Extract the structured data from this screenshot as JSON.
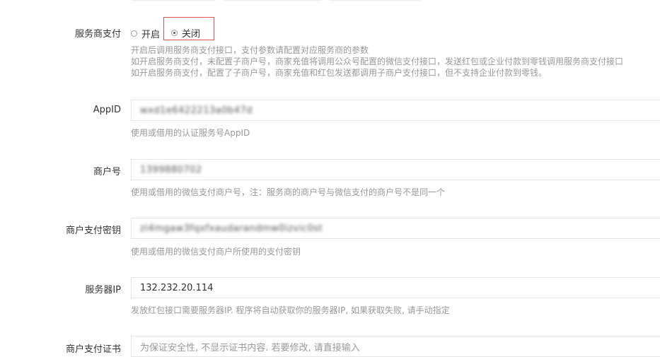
{
  "fields": {
    "sub_merchant_pay": {
      "label": "服务商支付",
      "option_on": "开启",
      "option_off": "关闭",
      "selected": "关闭",
      "help": [
        "开启后调用服务商支付接口，支付参数请配置对应服务商的参数",
        "如开启服务商支付，未配置子商户号，商家充值将调用公众号配置的微信支付接口，发送红包或企业付款到零钱调用服务商支付接口",
        "如开启服务商支付，配置了子商户号，商家充值和红包发送都调用子商户支付接口，但不支持企业付款到零钱。"
      ]
    },
    "appid": {
      "label": "AppID",
      "value": "wxd1e6422213a0b47d",
      "help": "使用或借用的认证服务号AppID"
    },
    "mch_id": {
      "label": "商户号",
      "value": "1399880702",
      "help": "使用或借用的微信支付商户号，注：服务商的商户号与微信支付的商户号不是同一个"
    },
    "pay_key": {
      "label": "商户支付密钥",
      "value": "zi4mgaw3fqxfxaudarandmw0izvic0st",
      "help": "使用或借用的微信支付商户所使用的支付密钥"
    },
    "server_ip": {
      "label": "服务器IP",
      "value": "132.232.20.114",
      "help": "发放红包接口需要服务器IP. 程序将自动获取你的服务器IP, 如果获取失败, 请手动指定"
    },
    "cert": {
      "label": "商户支付证书",
      "placeholder": "为保证安全性, 不显示证书内容. 若要修改, 请直接输入"
    }
  }
}
